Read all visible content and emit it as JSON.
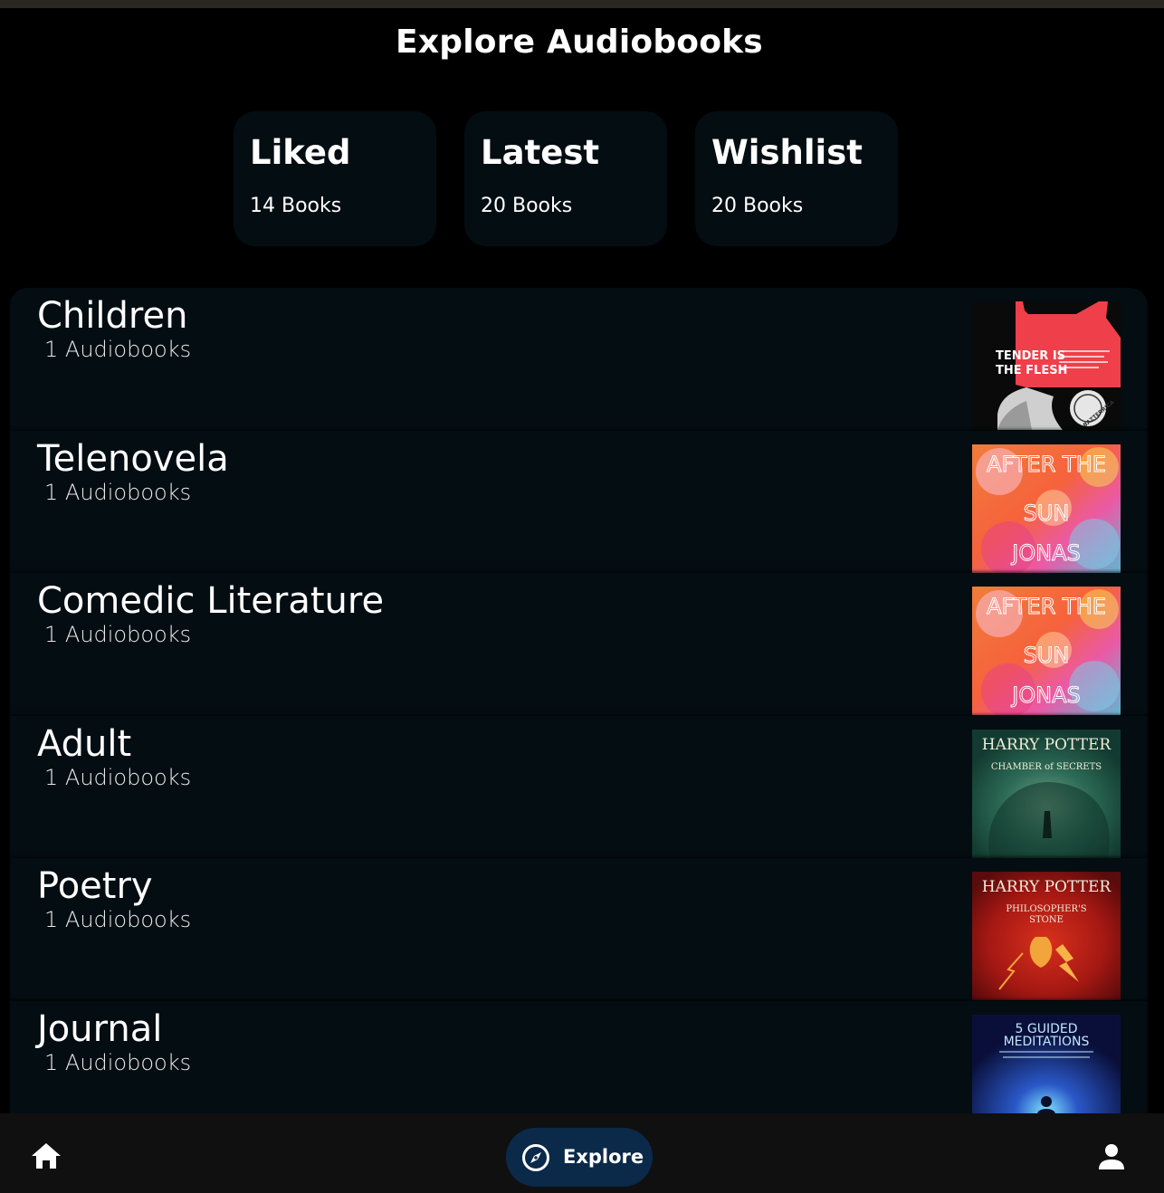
{
  "title": "Explore Audiobooks",
  "collections": [
    {
      "title": "Liked",
      "count": "14 Books"
    },
    {
      "title": "Latest",
      "count": "20 Books"
    },
    {
      "title": "Wishlist",
      "count": "20 Books"
    }
  ],
  "genres": [
    {
      "name": "Children",
      "count": "1 Audiobooks",
      "cover": {
        "title_line1": "TENDER IS",
        "title_line2": "THE FLESH",
        "author": "BAZTERRICA"
      }
    },
    {
      "name": "Telenovela",
      "count": "1 Audiobooks",
      "cover": {
        "title_line1": "AFTER THE",
        "title_line2": "SUN",
        "author": "JONAS"
      }
    },
    {
      "name": "Comedic Literature",
      "count": "1 Audiobooks",
      "cover": {
        "title_line1": "AFTER THE",
        "title_line2": "SUN",
        "author": "JONAS"
      }
    },
    {
      "name": "Adult",
      "count": "1 Audiobooks",
      "cover": {
        "title_line1": "HARRY POTTER",
        "title_line2": "CHAMBER of SECRETS"
      }
    },
    {
      "name": "Poetry",
      "count": "1 Audiobooks",
      "cover": {
        "title_line1": "HARRY POTTER",
        "title_line2": "PHILOSOPHER'S",
        "title_line3": "STONE"
      }
    },
    {
      "name": "Journal",
      "count": "1 Audiobooks",
      "cover": {
        "title_line1": "5 GUIDED",
        "title_line2": "MEDITATIONS"
      }
    }
  ],
  "nav": {
    "home_icon": "home-icon",
    "explore_label": "Explore",
    "explore_icon": "compass-icon",
    "profile_icon": "person-icon"
  },
  "colors": {
    "background": "#000000",
    "card": "#040d12",
    "nav_active": "#0b2a4a",
    "nav_bar": "#101010"
  }
}
